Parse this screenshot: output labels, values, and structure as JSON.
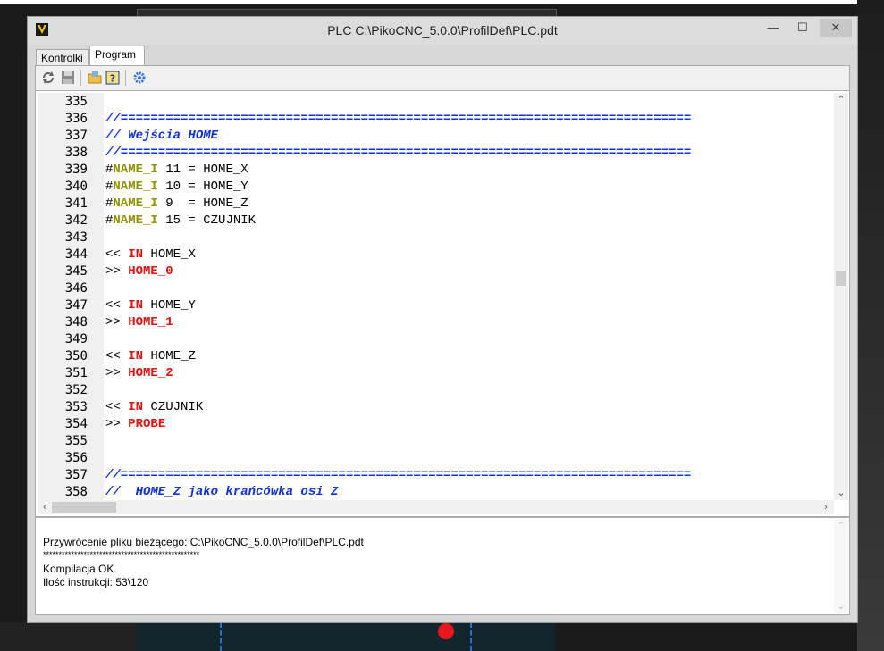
{
  "window": {
    "title": "PLC C:\\PikoCNC_5.0.0\\ProfilDef\\PLC.pdt",
    "minimize_glyph": "—",
    "maximize_glyph": "☐",
    "close_glyph": "✕",
    "icon": "app-logo-icon"
  },
  "tabs": [
    {
      "label": "Kontrolki",
      "selected": false
    },
    {
      "label": "Program",
      "selected": true
    }
  ],
  "toolbar": {
    "icons": [
      "refresh-icon",
      "save-icon",
      "open-folder-icon",
      "help-icon",
      "settings-icon"
    ]
  },
  "editor": {
    "lines": [
      {
        "no": "335",
        "tokens": []
      },
      {
        "no": "336",
        "tokens": [
          {
            "t": "//============================================================================",
            "c": "comment"
          }
        ]
      },
      {
        "no": "337",
        "tokens": [
          {
            "t": "// Wejścia HOME",
            "c": "comment"
          }
        ]
      },
      {
        "no": "338",
        "tokens": [
          {
            "t": "//============================================================================",
            "c": "comment"
          }
        ]
      },
      {
        "no": "339",
        "tokens": [
          {
            "t": "#",
            "c": "plain"
          },
          {
            "t": "NAME_I",
            "c": "define"
          },
          {
            "t": " 11 = HOME_X",
            "c": "plain"
          }
        ]
      },
      {
        "no": "340",
        "tokens": [
          {
            "t": "#",
            "c": "plain"
          },
          {
            "t": "NAME_I",
            "c": "define"
          },
          {
            "t": " 10 = HOME_Y",
            "c": "plain"
          }
        ]
      },
      {
        "no": "341",
        "tokens": [
          {
            "t": "#",
            "c": "plain"
          },
          {
            "t": "NAME_I",
            "c": "define"
          },
          {
            "t": " 9  = HOME_Z",
            "c": "plain"
          }
        ]
      },
      {
        "no": "342",
        "tokens": [
          {
            "t": "#",
            "c": "plain"
          },
          {
            "t": "NAME_I",
            "c": "define"
          },
          {
            "t": " 15 = CZUJNIK",
            "c": "plain"
          }
        ]
      },
      {
        "no": "343",
        "tokens": []
      },
      {
        "no": "344",
        "tokens": [
          {
            "t": "<< ",
            "c": "plain"
          },
          {
            "t": "IN",
            "c": "kw"
          },
          {
            "t": " HOME_X",
            "c": "plain"
          }
        ]
      },
      {
        "no": "345",
        "tokens": [
          {
            "t": ">> ",
            "c": "plain"
          },
          {
            "t": "HOME_0",
            "c": "kw"
          }
        ]
      },
      {
        "no": "346",
        "tokens": []
      },
      {
        "no": "347",
        "tokens": [
          {
            "t": "<< ",
            "c": "plain"
          },
          {
            "t": "IN",
            "c": "kw"
          },
          {
            "t": " HOME_Y",
            "c": "plain"
          }
        ]
      },
      {
        "no": "348",
        "tokens": [
          {
            "t": ">> ",
            "c": "plain"
          },
          {
            "t": "HOME_1",
            "c": "kw"
          }
        ]
      },
      {
        "no": "349",
        "tokens": []
      },
      {
        "no": "350",
        "tokens": [
          {
            "t": "<< ",
            "c": "plain"
          },
          {
            "t": "IN",
            "c": "kw"
          },
          {
            "t": " HOME_Z",
            "c": "plain"
          }
        ]
      },
      {
        "no": "351",
        "tokens": [
          {
            "t": ">> ",
            "c": "plain"
          },
          {
            "t": "HOME_2",
            "c": "kw"
          }
        ]
      },
      {
        "no": "352",
        "tokens": []
      },
      {
        "no": "353",
        "tokens": [
          {
            "t": "<< ",
            "c": "plain"
          },
          {
            "t": "IN",
            "c": "kw"
          },
          {
            "t": " CZUJNIK",
            "c": "plain"
          }
        ]
      },
      {
        "no": "354",
        "tokens": [
          {
            "t": ">> ",
            "c": "plain"
          },
          {
            "t": "PROBE",
            "c": "kw"
          }
        ]
      },
      {
        "no": "355",
        "tokens": []
      },
      {
        "no": "356",
        "tokens": []
      },
      {
        "no": "357",
        "tokens": [
          {
            "t": "//============================================================================",
            "c": "comment"
          }
        ]
      },
      {
        "no": "358",
        "tokens": [
          {
            "t": "//  HOME_Z jako krańcówka osi Z",
            "c": "comment"
          }
        ]
      }
    ]
  },
  "output": {
    "lines": [
      "Przywrócenie pliku bieżącego: C:\\PikoCNC_5.0.0\\ProfilDef\\PLC.pdt",
      "**************************************************",
      "Kompilacja OK.",
      "Ilość instrukcji: 53\\120"
    ]
  },
  "colors": {
    "comment": "#1030d8",
    "keyword": "#e01010",
    "define": "#909000",
    "accent_dot": "#e8171d"
  }
}
